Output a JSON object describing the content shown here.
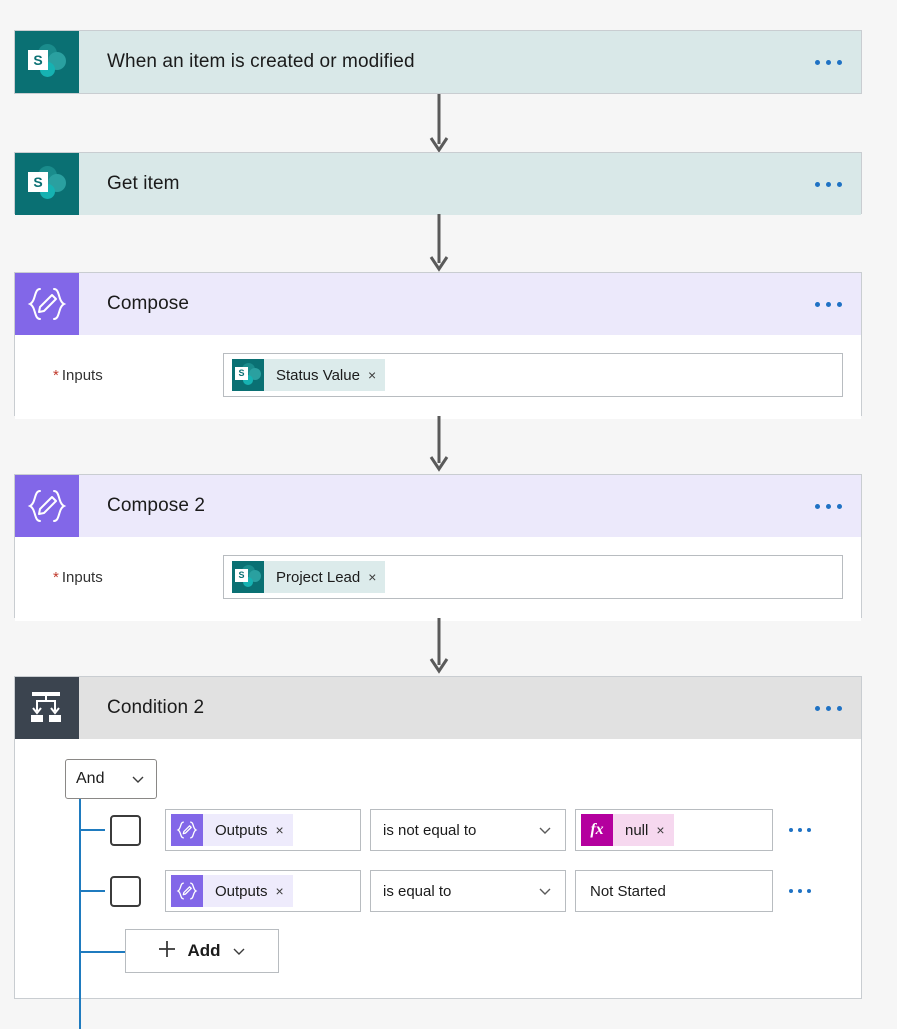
{
  "canvas": {
    "background": "#f6f6f6"
  },
  "colors": {
    "sharepoint_teal": "#0a7073",
    "sharepoint_header": "#d9e8e8",
    "compose_purple": "#8267e8",
    "compose_header": "#ece9fb",
    "condition_icon": "#3b444f",
    "condition_header": "#e1e1e1",
    "expression_magenta": "#b4009e",
    "link_blue": "#1f72c4",
    "tree_blue": "#1f7bbf",
    "required_red": "#c0392b"
  },
  "nodes": [
    {
      "id": "trigger",
      "title": "When an item is created or modified",
      "icon": "sharepoint-icon",
      "type": "sharepoint",
      "overflow_label": "More commands"
    },
    {
      "id": "get_item",
      "title": "Get item",
      "icon": "sharepoint-icon",
      "type": "sharepoint",
      "overflow_label": "More commands"
    },
    {
      "id": "compose",
      "title": "Compose",
      "icon": "compose-icon",
      "type": "compose",
      "overflow_label": "More commands",
      "field": {
        "required_marker": "*",
        "label": "Inputs",
        "token": {
          "icon": "sharepoint-icon",
          "label": "Status Value",
          "remove_label": "×"
        }
      }
    },
    {
      "id": "compose_2",
      "title": "Compose 2",
      "icon": "compose-icon",
      "type": "compose",
      "overflow_label": "More commands",
      "field": {
        "required_marker": "*",
        "label": "Inputs",
        "token": {
          "icon": "sharepoint-icon",
          "label": "Project Lead",
          "remove_label": "×"
        }
      }
    },
    {
      "id": "condition_2",
      "title": "Condition 2",
      "icon": "condition-icon",
      "type": "condition",
      "overflow_label": "More commands"
    }
  ],
  "condition": {
    "logic_operator": "And",
    "logic_operator_chevron": "chevron-down-icon",
    "rows": [
      {
        "checkbox_checked": false,
        "token": {
          "icon": "compose-icon",
          "label": "Outputs",
          "remove_label": "×"
        },
        "operator": "is not equal to",
        "value_type": "expression",
        "value_token": {
          "icon": "fx-icon",
          "label": "null",
          "remove_label": "×"
        },
        "overflow_label": "More commands"
      },
      {
        "checkbox_checked": false,
        "token": {
          "icon": "compose-icon",
          "label": "Outputs",
          "remove_label": "×"
        },
        "operator": "is equal to",
        "value_type": "text",
        "value_text": "Not Started",
        "overflow_label": "More commands"
      }
    ],
    "add_button": {
      "plus_icon": "plus-icon",
      "label": "Add",
      "chevron": "chevron-down-icon"
    }
  }
}
